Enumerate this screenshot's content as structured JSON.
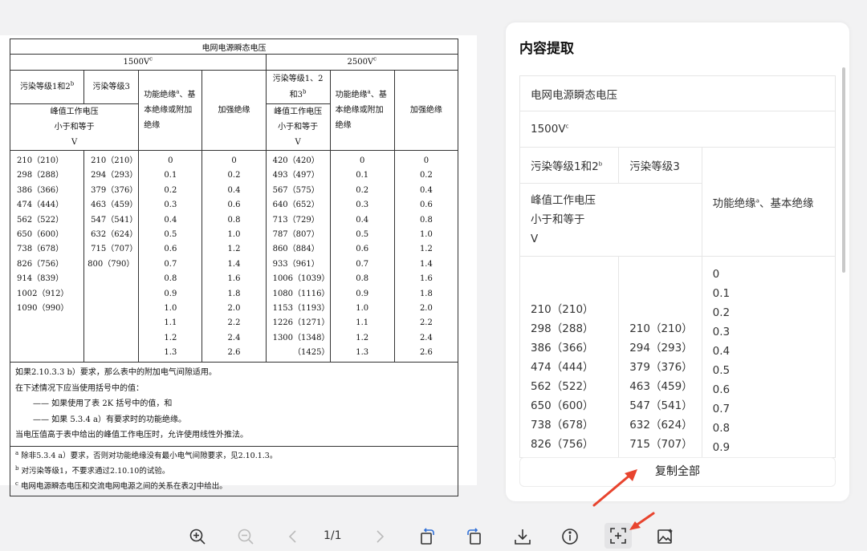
{
  "document": {
    "title": "电网电源瞬态电压",
    "voltage_left": "1500V",
    "voltage_left_sup": "c",
    "voltage_right": "2500V",
    "voltage_right_sup": "c",
    "col_pollution12": "污染等级1和2",
    "col_pollution12_sup": "b",
    "col_pollution3": "污染等级3",
    "col_functional_l1": "功能绝缘",
    "col_functional_sup": "a",
    "col_functional_l2": "、基",
    "col_functional_l3": "本绝缘或附加",
    "col_functional_l4": "绝缘",
    "col_reinforced": "加强绝缘",
    "col_pollution123_l1": "污染等级1、2",
    "col_pollution123_l2": "和3",
    "col_pollution123_sup": "b",
    "peak_l1": "峰值工作电压",
    "peak_l2": "小于和等于",
    "peak_l3": "V",
    "data_c1": "210（210）\n298（288）\n386（366）\n474（444）\n562（522）\n650（600）\n738（678）\n826（756）\n914（839）\n1002（912）\n1090（990）",
    "data_c2a": "210（210）\n294（293）\n379（376）\n463（459）\n547（541）\n632（624）\n715（707）",
    "data_c2b": "800（790）",
    "data_c3": "0\n0.1\n0.2\n0.3\n0.4\n0.5\n0.6\n0.7\n0.8\n0.9\n1.0\n1.1\n1.2\n1.3",
    "data_c4": "0\n0.2\n0.4\n0.6\n0.8\n1.0\n1.2\n1.4\n1.6\n1.8\n2.0\n2.2\n2.4\n2.6",
    "data_c5": "420（420）\n493（497）\n567（575）\n640（652）\n713（729）\n787（807）\n860（884）\n933（961）\n1006（1039）\n1080（1116）\n1153（1193）\n1226（1271）\n1300（1348）\n        （1425）",
    "data_c6": "0\n0.1\n0.2\n0.3\n0.4\n0.5\n0.6\n0.7\n0.8\n0.9\n1.0\n1.1\n1.2\n1.3",
    "data_c7": "0\n0.2\n0.4\n0.6\n0.8\n1.0\n1.2\n1.4\n1.6\n1.8\n2.0\n2.2\n2.4\n2.6",
    "note1": "如果2.10.3.3 b）要求，那么表中的附加电气间隙适用。",
    "note2": "在下述情况下应当使用括号中的值：",
    "note3": "—— 如果使用了表 2K 括号中的值，和",
    "note4": "—— 如果 5.3.4 a）有要求时的功能绝缘。",
    "note5": "当电压值高于表中给出的峰值工作电压时，允许使用线性外推法。",
    "foot_a_sup": "a",
    "foot_a": "除非5.3.4 a）要求，否则对功能绝缘没有最小电气间隙要求，见2.10.1.3。",
    "foot_b_sup": "b",
    "foot_b": "对污染等级1，不要求通过2.10.10的试验。",
    "foot_c_sup": "c",
    "foot_c": "电网电源瞬态电压和交流电网电源之间的关系在表2J中给出。"
  },
  "panel": {
    "title": "内容提取",
    "row_title": "电网电源瞬态电压",
    "row_voltage": "1500V",
    "row_voltage_sup": "c",
    "col_a": "污染等级1和2",
    "col_a_sup": "b",
    "col_b": "污染等级3",
    "col_c_prefix": "功能绝缘",
    "col_c_sup": "a",
    "col_c_suffix": "、基本绝缘",
    "peak": "峰值工作电压\n小于和等于\nV",
    "data_a": "210（210）\n298（288）\n386（366）\n474（444）\n562（522）\n650（600）\n738（678）\n826（756）",
    "data_b": "210（210）\n294（293）\n379（376）\n463（459）\n547（541）\n632（624）\n715（707）",
    "data_c": "0\n0.1\n0.2\n0.3\n0.4\n0.5\n0.6\n0.7\n0.8\n0.9",
    "copy_all": "复制全部"
  },
  "toolbar": {
    "page_indicator": "1/1",
    "icons": [
      "zoom-in-icon",
      "zoom-out-icon",
      "prev-page-icon",
      "next-page-icon",
      "rotate-left-icon",
      "rotate-right-icon",
      "download-icon",
      "info-icon",
      "extract-text-icon",
      "image-ai-icon"
    ]
  },
  "colors": {
    "accent_arrow": "#e8442e",
    "panel_bg": "#ffffff",
    "page_bg": "#f2f2f3"
  }
}
